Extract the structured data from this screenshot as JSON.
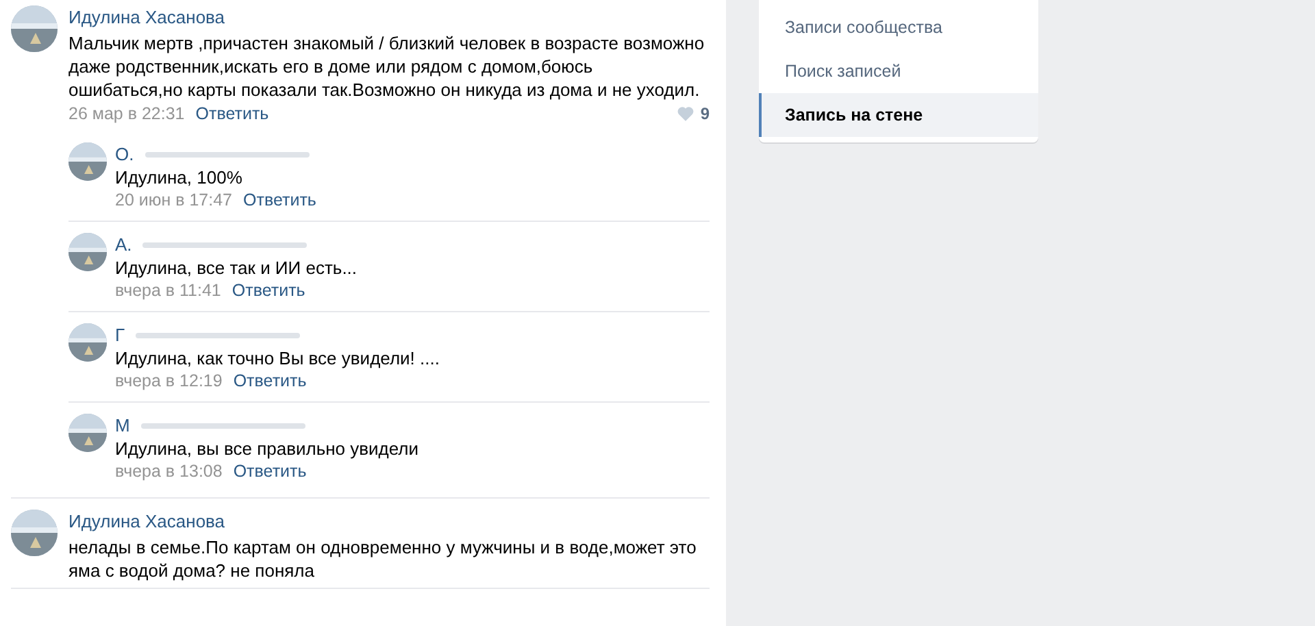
{
  "comments": [
    {
      "author": "Идулина Хасанова",
      "redacted": false,
      "text": "Мальчик мертв ,причастен знакомый / близкий человек в возрасте возможно даже родственник,искать его в доме или рядом с домом,боюсь ошибаться,но карты показали так.Возможно он никуда из дома и не уходил.",
      "date": "26 мар в 22:31",
      "reply": "Ответить",
      "likes": "9",
      "replies": [
        {
          "author": "О.",
          "redacted": true,
          "text": "Идулина, 100%",
          "date": "20 июн в 17:47",
          "reply": "Ответить"
        },
        {
          "author": "А.",
          "redacted": true,
          "text": "Идулина, все так и ИИ есть...",
          "date": "вчера в 11:41",
          "reply": "Ответить"
        },
        {
          "author": "Г",
          "redacted": true,
          "text": "Идулина, как точно Вы все увидели! ....",
          "date": "вчера в 12:19",
          "reply": "Ответить"
        },
        {
          "author": "М",
          "redacted": true,
          "text": "Идулина, вы все правильно увидели",
          "date": "вчера в 13:08",
          "reply": "Ответить"
        }
      ]
    },
    {
      "author": "Идулина Хасанова",
      "redacted": false,
      "text": "нелады в семье.По картам он одновременно у мужчины и в воде,может это яма с водой дома? не поняла"
    }
  ],
  "menu": [
    {
      "label": "Записи сообщества",
      "selected": false
    },
    {
      "label": "Поиск записей",
      "selected": false
    },
    {
      "label": "Запись на стене",
      "selected": true
    }
  ]
}
